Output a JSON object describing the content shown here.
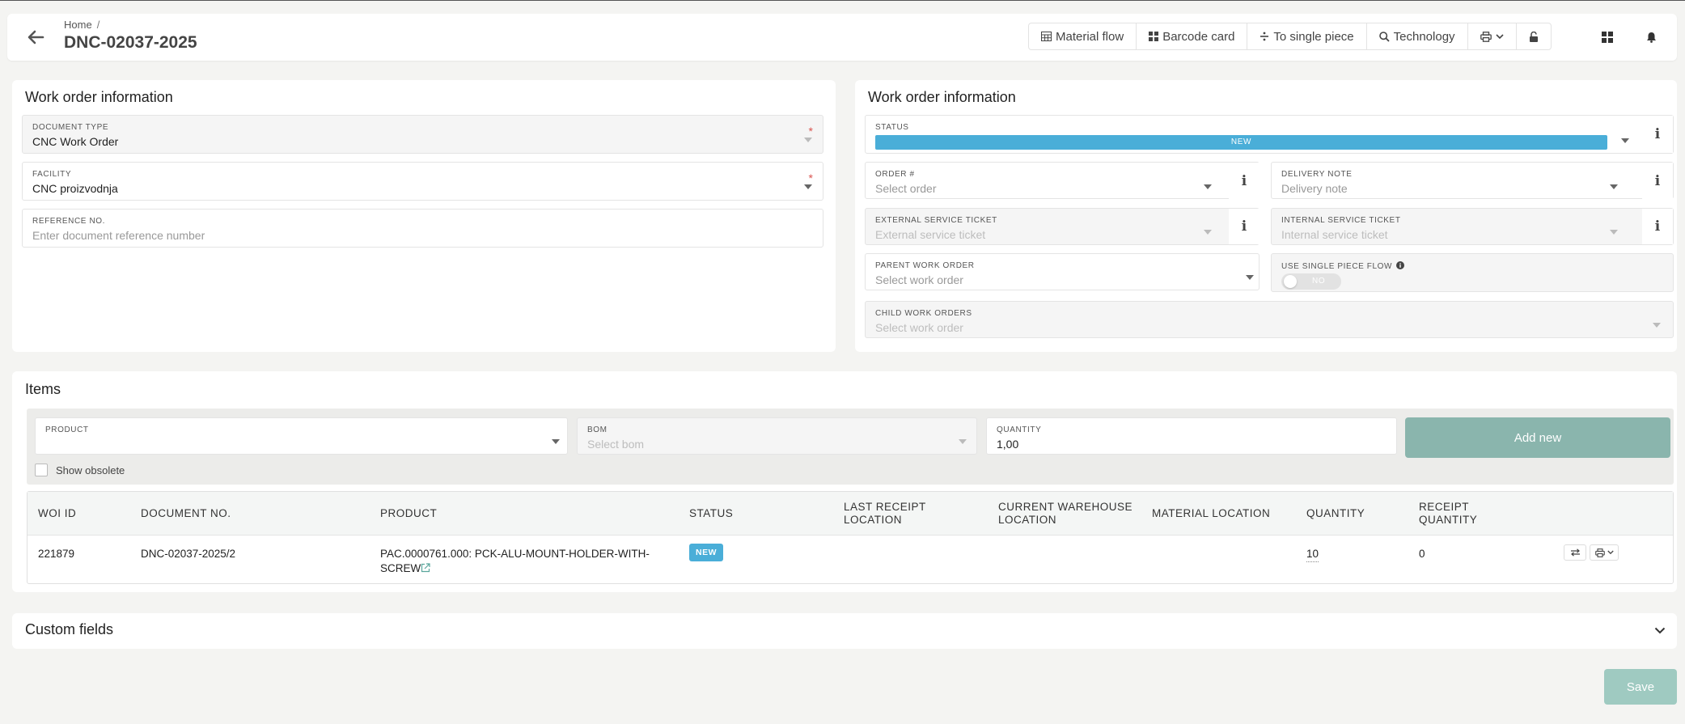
{
  "header": {
    "breadcrumb_home": "Home",
    "breadcrumb_sep": "/",
    "title": "DNC-02037-2025",
    "toolbar": {
      "material_flow": "Material flow",
      "barcode_card": "Barcode card",
      "to_single_piece": "To single piece",
      "technology": "Technology"
    }
  },
  "left_panel": {
    "title": "Work order information",
    "document_type": {
      "label": "DOCUMENT TYPE",
      "value": "CNC Work Order",
      "required_mark": "*"
    },
    "facility": {
      "label": "FACILITY",
      "value": "CNC proizvodnja",
      "required_mark": "*"
    },
    "reference": {
      "label": "REFERENCE NO.",
      "placeholder": "Enter document reference number"
    }
  },
  "right_panel": {
    "title": "Work order information",
    "status": {
      "label": "STATUS",
      "value": "NEW",
      "color": "#4aaed8"
    },
    "order": {
      "label": "ORDER #",
      "placeholder": "Select order"
    },
    "delivery_note": {
      "label": "DELIVERY NOTE",
      "placeholder": "Delivery note"
    },
    "external_ticket": {
      "label": "EXTERNAL SERVICE TICKET",
      "placeholder": "External service ticket"
    },
    "internal_ticket": {
      "label": "INTERNAL SERVICE TICKET",
      "placeholder": "Internal service ticket"
    },
    "parent_wo": {
      "label": "PARENT WORK ORDER",
      "placeholder": "Select work order"
    },
    "single_piece": {
      "label": "USE SINGLE PIECE FLOW",
      "toggle_text": "NO"
    },
    "child_wo": {
      "label": "CHILD WORK ORDERS",
      "placeholder": "Select work order"
    }
  },
  "items": {
    "title": "Items",
    "product_label": "PRODUCT",
    "bom_label": "BOM",
    "bom_placeholder": "Select bom",
    "quantity_label": "QUANTITY",
    "quantity_value": "1,00",
    "add_new": "Add new",
    "show_obsolete": "Show obsolete",
    "columns": {
      "woi_id": "WOI ID",
      "document_no": "DOCUMENT NO.",
      "product": "PRODUCT",
      "status": "STATUS",
      "last_receipt_1": "LAST RECEIPT",
      "last_receipt_2": "LOCATION",
      "current_wh_1": "CURRENT WAREHOUSE",
      "current_wh_2": "LOCATION",
      "material_location": "MATERIAL LOCATION",
      "quantity": "QUANTITY",
      "receipt_qty_1": "RECEIPT",
      "receipt_qty_2": "QUANTITY"
    },
    "rows": [
      {
        "woi_id": "221879",
        "document_no": "DNC-02037-2025/2",
        "product_line1": "PAC.0000761.000: PCK-ALU-MOUNT-HOLDER-WITH-",
        "product_line2": "SCREW",
        "status": "NEW",
        "quantity": "10",
        "receipt_quantity": "0"
      }
    ]
  },
  "custom_fields": {
    "title": "Custom fields"
  },
  "footer": {
    "save": "Save"
  },
  "colors": {
    "accent": "#4aaed8",
    "add_button": "#8ab5ad",
    "save_button": "#9fcac1"
  }
}
